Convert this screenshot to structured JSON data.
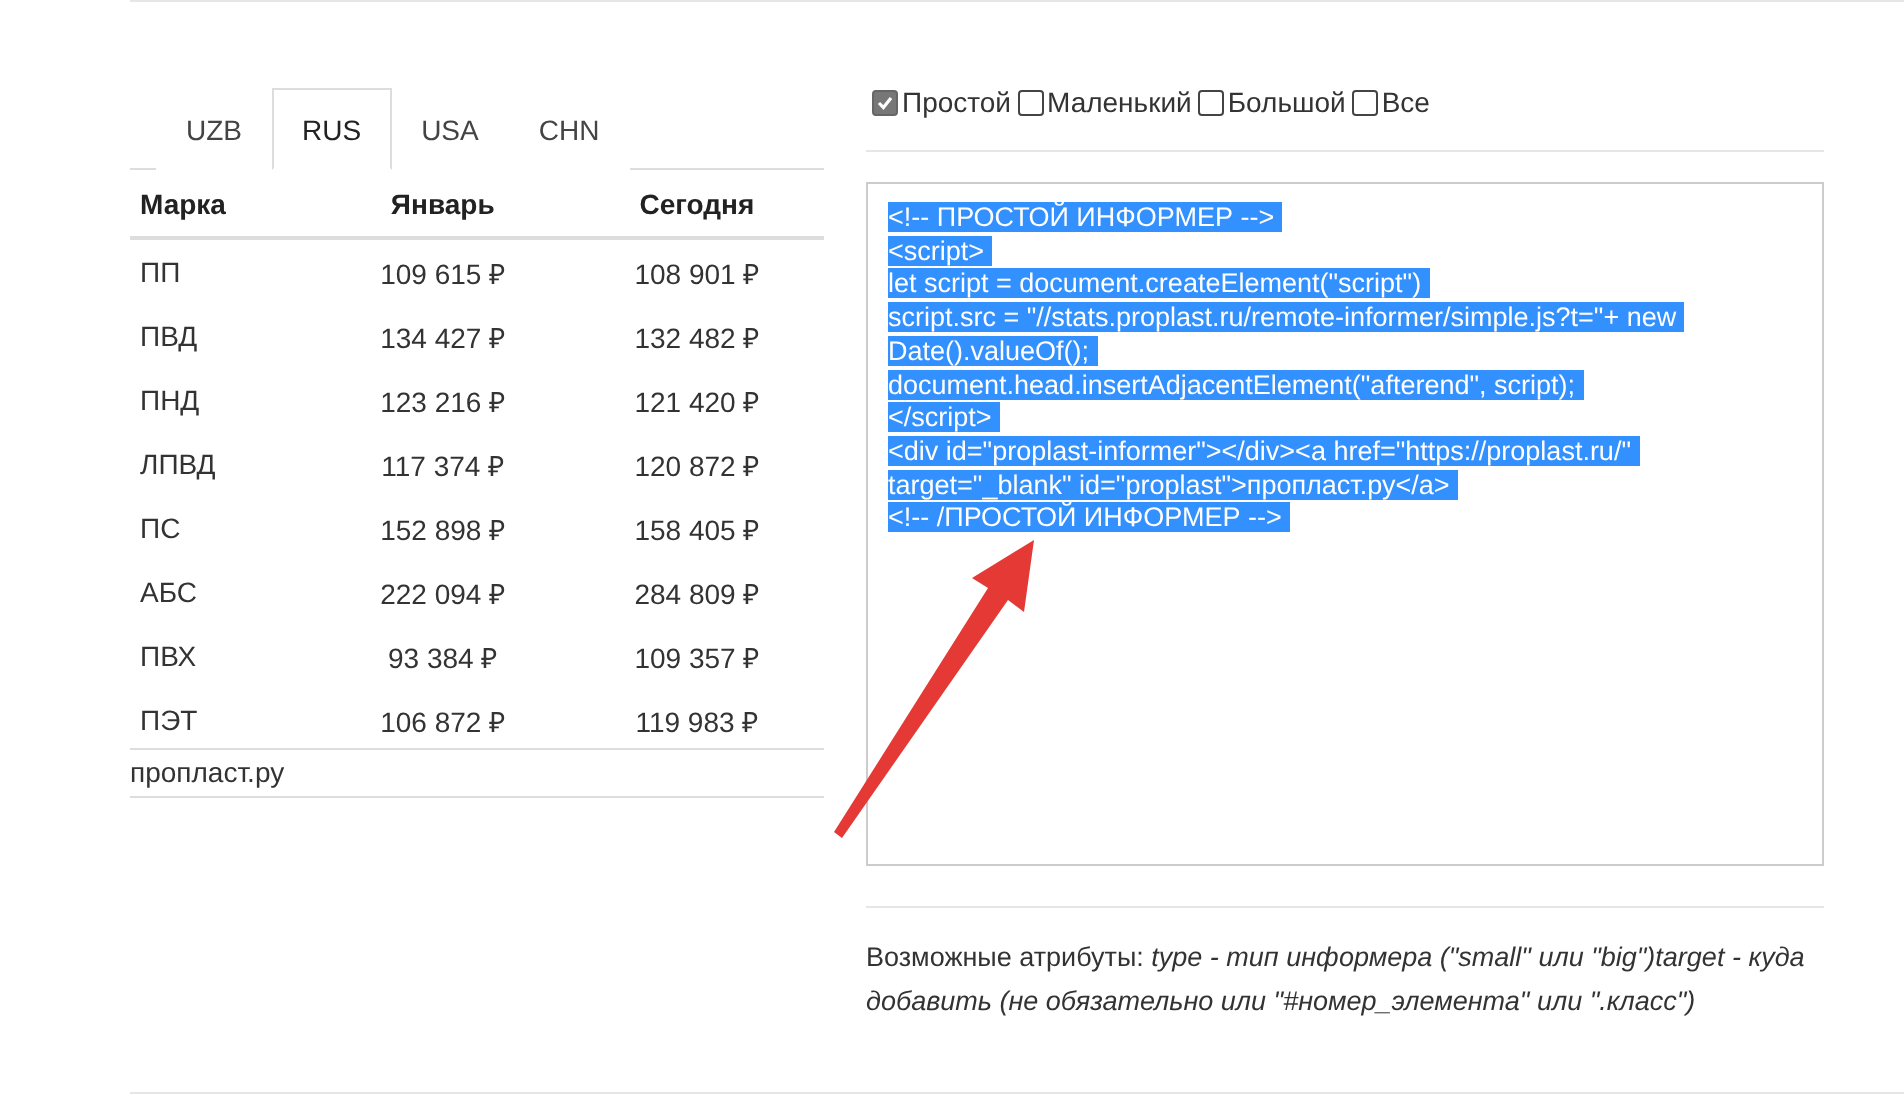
{
  "tabs": [
    {
      "label": "UZB",
      "selected": false
    },
    {
      "label": "RUS",
      "selected": true
    },
    {
      "label": "USA",
      "selected": false
    },
    {
      "label": "CHN",
      "selected": false
    }
  ],
  "table": {
    "columns": [
      "Марка",
      "Январь",
      "Сегодня"
    ],
    "rows": [
      [
        "ПП",
        "109 615 ₽",
        "108 901 ₽"
      ],
      [
        "ПВД",
        "134 427 ₽",
        "132 482 ₽"
      ],
      [
        "ПНД",
        "123 216 ₽",
        "121 420 ₽"
      ],
      [
        "ЛПВД",
        "117 374 ₽",
        "120 872 ₽"
      ],
      [
        "ПС",
        "152 898 ₽",
        "158 405 ₽"
      ],
      [
        "АБС",
        "222 094 ₽",
        "284 809 ₽"
      ],
      [
        "ПВХ",
        "93 384 ₽",
        "109 357 ₽"
      ],
      [
        "ПЭТ",
        "106 872 ₽",
        "119 983 ₽"
      ]
    ],
    "footer": "пропласт.ру"
  },
  "options": [
    {
      "label": "Простой",
      "checked": true
    },
    {
      "label": "Маленький",
      "checked": false
    },
    {
      "label": "Большой",
      "checked": false
    },
    {
      "label": "Все",
      "checked": false
    }
  ],
  "code": {
    "selected": true,
    "lines": [
      "<!-- ПРОСТОЙ ИНФОРМЕР -->",
      "<script>",
      "let script = document.createElement(\"script\")",
      "script.src = \"//stats.proplast.ru/remote-informer/simple.js?t=\"+ new",
      "Date().valueOf();",
      "document.head.insertAdjacentElement(\"afterend\", script);",
      "</script>",
      "<div id=\"proplast-informer\"></div><a href=\"https://proplast.ru/\"",
      "target=\"_blank\" id=\"proplast\">пропласт.ру</a>",
      "<!-- /ПРОСТОЙ ИНФОРМЕР -->"
    ]
  },
  "description": "Возможные атрибуты: *type - тип информера (\"small\" или \"big\")target - куда добавить (не обязательно или \"#номер_элемента\" или \".класс\")*"
}
